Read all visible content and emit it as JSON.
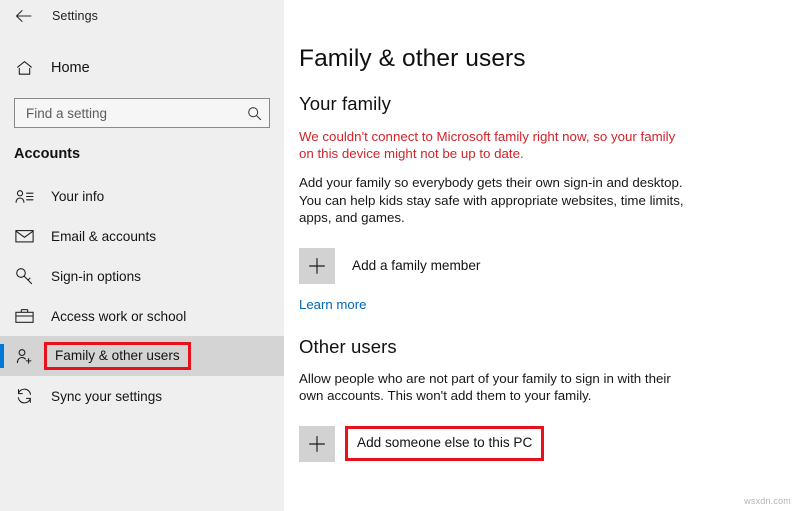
{
  "window": {
    "app_title": "Settings",
    "back_icon": "back-arrow-icon"
  },
  "sidebar": {
    "home": {
      "label": "Home",
      "icon": "home-icon"
    },
    "search": {
      "placeholder": "Find a setting",
      "value": "",
      "icon": "search-icon"
    },
    "category": "Accounts",
    "items": [
      {
        "label": "Your info",
        "icon": "user-info-icon",
        "selected": false
      },
      {
        "label": "Email & accounts",
        "icon": "envelope-icon",
        "selected": false
      },
      {
        "label": "Sign-in options",
        "icon": "key-icon",
        "selected": false
      },
      {
        "label": "Access work or school",
        "icon": "briefcase-icon",
        "selected": false
      },
      {
        "label": "Family & other users",
        "icon": "add-user-icon",
        "selected": true
      },
      {
        "label": "Sync your settings",
        "icon": "sync-icon",
        "selected": false
      }
    ]
  },
  "main": {
    "page_title": "Family & other users",
    "your_family": {
      "heading": "Your family",
      "error": "We couldn't connect to Microsoft family right now, so your family on this device might not be up to date.",
      "description": "Add your family so everybody gets their own sign-in and desktop. You can help kids stay safe with appropriate websites, time limits, apps, and games.",
      "add_button": "Add a family member",
      "learn_more": "Learn more"
    },
    "other_users": {
      "heading": "Other users",
      "description": "Allow people who are not part of your family to sign in with their own accounts. This won't add them to your family.",
      "add_button": "Add someone else to this PC"
    }
  },
  "colors": {
    "accent": "#0078d7",
    "highlight_box": "#e8111b",
    "error_text": "#d1232a",
    "link": "#0067b8",
    "sidebar_bg": "#efefef",
    "selected_row_bg": "#d4d4d4"
  },
  "watermark": "wsxdn.com"
}
